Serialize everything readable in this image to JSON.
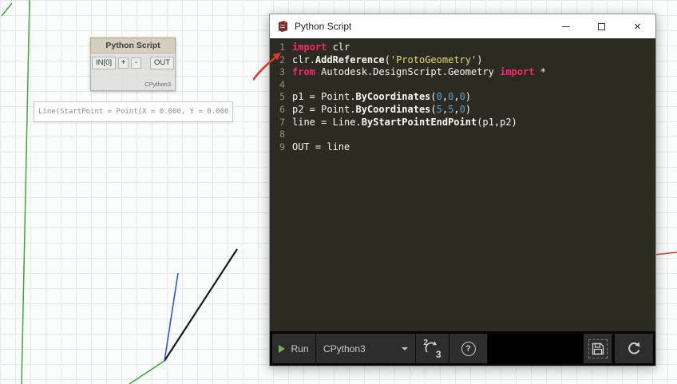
{
  "canvas": {
    "node": {
      "title": "Python Script",
      "input_port": "IN[0]",
      "add_button": "+",
      "remove_button": "-",
      "output_port": "OUT",
      "engine_label": "CPython3"
    },
    "preview_tooltip": "Line(StartPoint = Point(X = 0.000, Y = 0.000"
  },
  "window": {
    "title": "Python Script",
    "close_glyph": "×"
  },
  "code": {
    "lines": [
      {
        "no": "1",
        "segs": [
          [
            "k",
            "import"
          ],
          [
            "p",
            " clr"
          ]
        ]
      },
      {
        "no": "2",
        "segs": [
          [
            "p",
            "clr."
          ],
          [
            "b",
            "AddReference"
          ],
          [
            "p",
            "("
          ],
          [
            "s",
            "'ProtoGeometry'"
          ],
          [
            "p",
            ")"
          ]
        ]
      },
      {
        "no": "3",
        "segs": [
          [
            "k",
            "from"
          ],
          [
            "p",
            " Autodesk.DesignScript.Geometry "
          ],
          [
            "k",
            "import"
          ],
          [
            "p",
            " *"
          ]
        ]
      },
      {
        "no": "4",
        "segs": []
      },
      {
        "no": "5",
        "segs": [
          [
            "p",
            "p1 = Point."
          ],
          [
            "b",
            "ByCoordinates"
          ],
          [
            "p",
            "("
          ],
          [
            "n",
            "0"
          ],
          [
            "p",
            ","
          ],
          [
            "n",
            "0"
          ],
          [
            "p",
            ","
          ],
          [
            "n",
            "0"
          ],
          [
            "p",
            ")"
          ]
        ]
      },
      {
        "no": "6",
        "segs": [
          [
            "p",
            "p2 = Point."
          ],
          [
            "b",
            "ByCoordinates"
          ],
          [
            "p",
            "("
          ],
          [
            "n",
            "5"
          ],
          [
            "p",
            ","
          ],
          [
            "n",
            "5"
          ],
          [
            "p",
            ","
          ],
          [
            "n",
            "0"
          ],
          [
            "p",
            ")"
          ]
        ]
      },
      {
        "no": "7",
        "segs": [
          [
            "p",
            "line = Line."
          ],
          [
            "b",
            "ByStartPointEndPoint"
          ],
          [
            "p",
            "(p1,p2)"
          ]
        ]
      },
      {
        "no": "8",
        "segs": []
      },
      {
        "no": "9",
        "segs": [
          [
            "p",
            "OUT = line"
          ]
        ]
      }
    ]
  },
  "toolbar": {
    "run_label": "Run",
    "engine_value": "CPython3",
    "help_glyph": "?",
    "migration_from": "2",
    "migration_to": "3"
  },
  "colors": {
    "keyword": "#f92672",
    "string": "#e6db74",
    "number": "#5a9fd4",
    "plain": "#f8f8f2",
    "line_number": "#90908a",
    "run_play": "#73b152",
    "editor_bg": "#2b2b22",
    "annotation_arrow": "#e2352c"
  }
}
